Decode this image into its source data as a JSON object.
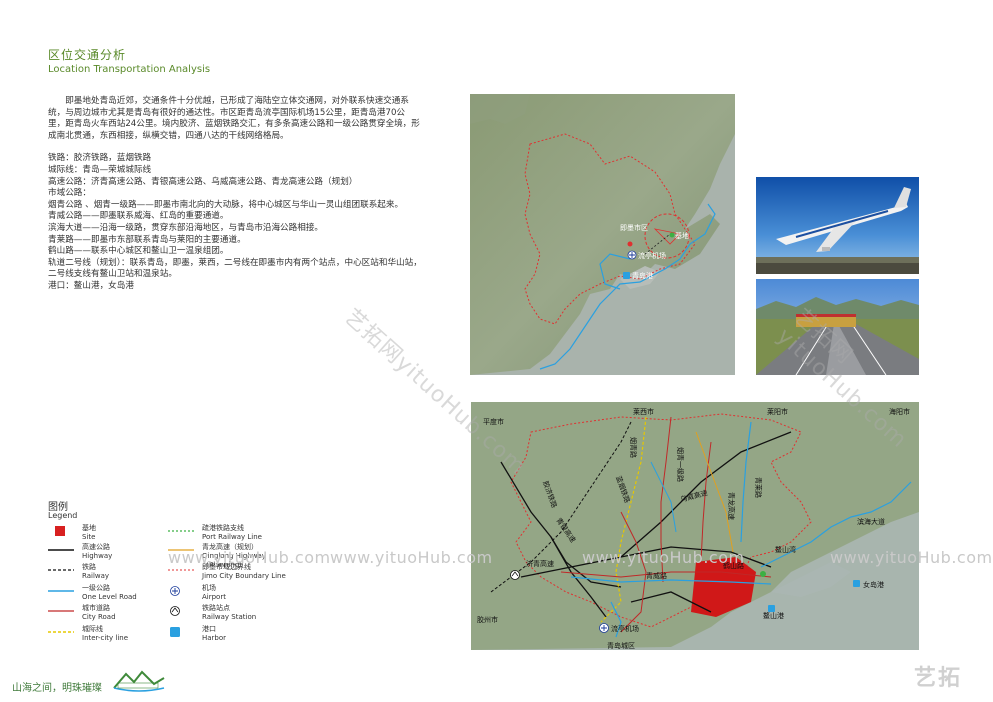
{
  "header": {
    "title_cn": "区位交通分析",
    "title_en": "Location Transportation Analysis"
  },
  "body": {
    "intro": "即墨地处青岛近郊，交通条件十分优越，已形成了海陆空立体交通网，对外联系快速交通系统，与周边城市尤其是青岛有很好的通达性。市区距青岛流亭国际机场15公里，距青岛港70公里，距青岛火车西站24公里。境内胶济、蓝烟铁路交汇，有多条高速公路和一级公路贯穿全境，形成南北贯通，东西相接，纵横交错，四通八达的干线网络格局。",
    "lines": [
      "铁路：胶济铁路，蓝烟铁路",
      "城际线：青岛—荣城城际线",
      "高速公路：济青高速公路、青银高速公路、乌威高速公路、青龙高速公路（规划）",
      "市域公路：",
      "烟青公路 、烟青一级路——即墨市南北向的大动脉，将中心城区与华山一灵山组团联系起来。",
      "青威公路——即墨联系威海、红岛的重要通道。",
      "滨海大道——沿海一级路，贯穿东部沿海地区，与青岛市沿海公路相接。",
      "青莱路——即墨市东部联系青岛与莱阳的主要通道。",
      "鹤山路——联系中心城区和鳌山卫一温泉组团。",
      "轨道二号线（规划）：联系青岛，即墨，莱西，二号线在即墨市内有两个站点，中心区站和华山站，二号线支线有鳌山卫站和温泉站。",
      "港口：鳌山港，女岛港"
    ]
  },
  "map1": {
    "labels": {
      "jimo": "即墨市区",
      "base": "基地",
      "airport": "流亭机场",
      "port": "青岛港"
    }
  },
  "map2": {
    "labels": {
      "pingdu": "平度市",
      "laixi": "莱西市",
      "laiyang": "莱阳市",
      "haiyang": "海阳市",
      "yanqing1": "烟青路",
      "yanqing2": "烟青一级路",
      "jiaoji": "胶济铁路",
      "lanyan": "蓝烟铁路",
      "wuwei": "乌威高速",
      "qinglong": "青龙高速",
      "qinglai": "青莱路",
      "qingyin": "青银高速",
      "jiqing": "济青高速",
      "qingwei": "青威路",
      "heshan": "鹤山路",
      "binhai": "滨海大道",
      "aoshanwan": "鳌山湾",
      "nvdao": "女岛港",
      "aoshan": "鳌山港",
      "jiaozhou": "胶州市",
      "liuting": "流亭机场",
      "qingdao": "青岛城区",
      "rail_vert": "铁路"
    }
  },
  "legend": {
    "title_cn": "图例",
    "title_en": "Legend",
    "items": [
      {
        "cn": "基地",
        "en": "Site"
      },
      {
        "cn": "高速公路",
        "en": "Highway"
      },
      {
        "cn": "铁路",
        "en": "Railway"
      },
      {
        "cn": "一级公路",
        "en": "One Level Road"
      },
      {
        "cn": "城市道路",
        "en": "City Road"
      },
      {
        "cn": "城际线",
        "en": "Inter-city line"
      },
      {
        "cn": "疏港铁路支线",
        "en": "Port Railway Line"
      },
      {
        "cn": "青龙高速（规划）",
        "en": "Qinglong Highway（Planning）"
      },
      {
        "cn": "即墨市域边界线",
        "en": "Jimo City Boundary Line"
      },
      {
        "cn": "机场",
        "en": "Airport"
      },
      {
        "cn": "铁路站点",
        "en": "Railway Station"
      },
      {
        "cn": "港口",
        "en": "Harbor"
      }
    ]
  },
  "watermarks": {
    "text": "www.yituoHub.com",
    "diag1": "艺拓网yituoHub.com",
    "diag2": "艺拓网yituoHub.com"
  },
  "footer": {
    "slogan": "山海之间，明珠璀璨",
    "corner": "艺拓"
  },
  "colors": {
    "accent_green": "#5a8a2a",
    "site_red": "#d82020",
    "boundary_red": "#e03030",
    "one_level_blue": "#2aa0e0",
    "city_road_red": "#c02828",
    "highway_black": "#111111"
  }
}
